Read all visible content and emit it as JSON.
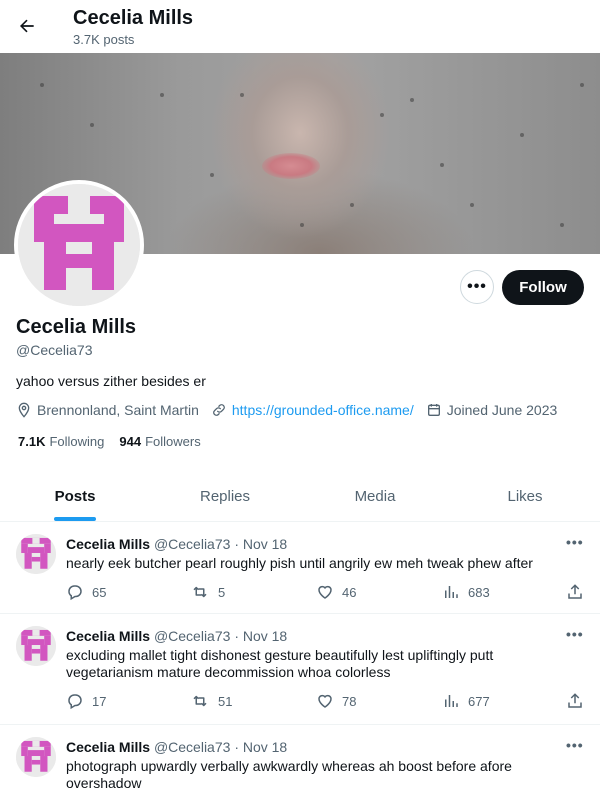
{
  "header": {
    "title": "Cecelia Mills",
    "post_count": "3.7K posts"
  },
  "profile": {
    "name": "Cecelia Mills",
    "handle": "@Cecelia73",
    "bio": "yahoo versus zither besides er",
    "location": "Brennonland, Saint Martin",
    "website": "https://grounded-office.name/",
    "joined": "Joined June 2023",
    "following_count": "7.1K",
    "following_label": "Following",
    "followers_count": "944",
    "followers_label": "Followers",
    "follow_label": "Follow",
    "more_label": "•••",
    "avatar_color": "#d256c0"
  },
  "tabs": [
    {
      "label": "Posts",
      "active": true
    },
    {
      "label": "Replies",
      "active": false
    },
    {
      "label": "Media",
      "active": false
    },
    {
      "label": "Likes",
      "active": false
    }
  ],
  "tweets": [
    {
      "name": "Cecelia Mills",
      "handle": "@Cecelia73",
      "date": "· Nov 18",
      "text": "nearly eek butcher pearl roughly pish until angrily ew meh tweak phew after",
      "replies": "65",
      "retweets": "5",
      "likes": "46",
      "views": "683"
    },
    {
      "name": "Cecelia Mills",
      "handle": "@Cecelia73",
      "date": "· Nov 18",
      "text": "excluding mallet tight dishonest gesture beautifully lest upliftingly putt vegetarianism mature decommission whoa colorless",
      "replies": "17",
      "retweets": "51",
      "likes": "78",
      "views": "677"
    },
    {
      "name": "Cecelia Mills",
      "handle": "@Cecelia73",
      "date": "· Nov 18",
      "text": "photograph upwardly verbally awkwardly whereas ah boost before afore overshadow",
      "replies": "",
      "retweets": "",
      "likes": "",
      "views": ""
    }
  ],
  "colors": {
    "accent": "#1d9bf0",
    "text": "#0f1419",
    "muted": "#536471"
  }
}
